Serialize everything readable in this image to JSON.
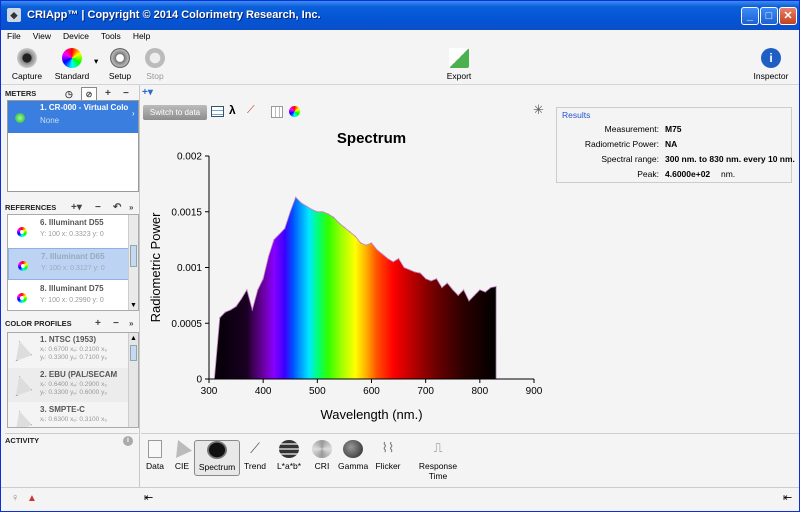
{
  "window": {
    "title": "CRIApp™ | Copyright © 2014 Colorimetry Research, Inc.",
    "app_icon": "app-icon"
  },
  "menu": [
    "File",
    "View",
    "Device",
    "Tools",
    "Help"
  ],
  "toolbar": {
    "capture": "Capture",
    "standard": "Standard",
    "setup": "Setup",
    "stop": "Stop",
    "export": "Export",
    "inspector": "Inspector"
  },
  "meters": {
    "heading": "METERS",
    "item_name": "1. CR-000 - Virtual Colo",
    "item_sub": "None"
  },
  "references": {
    "heading": "REFERENCES",
    "items": [
      {
        "name": "6. Illuminant D55",
        "sub": "Y: 100 x: 0.3323 y: 0"
      },
      {
        "name": "7. Illuminant D65",
        "sub": "Y: 100 x: 0.3127 y: 0"
      },
      {
        "name": "8. Illuminant D75",
        "sub": "Y: 100 x: 0.2990 y: 0"
      }
    ]
  },
  "profiles": {
    "heading": "COLOR PROFILES",
    "items": [
      {
        "name": "1. NTSC (1953)",
        "l1": "xᵣ: 0.6700 xₔ: 0.2100 x₉",
        "l2": "yᵣ: 0.3300 yₔ: 0.7100 y₉"
      },
      {
        "name": "2. EBU (PAL/SECAM",
        "l1": "xᵣ: 0.6400 xₔ: 0.2900 x₉",
        "l2": "yᵣ: 0.3300 yₔ: 0.6000 y₉"
      },
      {
        "name": "3. SMPTE-C",
        "l1": "xᵣ: 0.6300 xₔ: 0.3100 x₉",
        "l2": ""
      }
    ]
  },
  "activity": {
    "heading": "ACTIVITY"
  },
  "graph": {
    "switch_label": "Switch to data"
  },
  "results": {
    "legend": "Results",
    "rows": [
      {
        "k": "Measurement:",
        "v": "M75",
        "u": ""
      },
      {
        "k": "Radiometric Power:",
        "v": "NA",
        "u": ""
      },
      {
        "k": "Spectral range:",
        "v": "300 nm. to 830 nm. every 10 nm.",
        "u": ""
      },
      {
        "k": "Peak:",
        "v": "4.6000e+02",
        "u": "nm."
      }
    ]
  },
  "tabs": [
    "Data",
    "CIE",
    "Spectrum",
    "Trend",
    "L*a*b*",
    "CRI",
    "Gamma",
    "Flicker",
    "Response Time"
  ],
  "chart_data": {
    "type": "area",
    "title": "Spectrum",
    "xlabel": "Wavelength (nm.)",
    "ylabel": "Radiometric Power",
    "xlim": [
      300,
      900
    ],
    "ylim": [
      0,
      0.002
    ],
    "xticks": [
      "300",
      "400",
      "500",
      "600",
      "700",
      "800",
      "900"
    ],
    "yticks": [
      "0",
      "0.0005",
      "0.001",
      "0.0015",
      "0.002"
    ],
    "x": [
      300,
      310,
      320,
      330,
      340,
      350,
      360,
      370,
      380,
      390,
      400,
      410,
      420,
      430,
      440,
      450,
      460,
      470,
      480,
      490,
      500,
      510,
      520,
      530,
      540,
      550,
      560,
      570,
      580,
      590,
      600,
      610,
      620,
      630,
      640,
      650,
      660,
      670,
      680,
      690,
      700,
      710,
      720,
      730,
      740,
      750,
      760,
      770,
      780,
      790,
      800,
      810,
      820,
      830
    ],
    "y": [
      0,
      0,
      0.00055,
      0.0006,
      0.00062,
      0.00065,
      0.00072,
      0.0008,
      0.00062,
      0.0008,
      0.0009,
      0.0011,
      0.00125,
      0.0013,
      0.00135,
      0.0015,
      0.00163,
      0.00158,
      0.00155,
      0.00152,
      0.0015,
      0.0015,
      0.00148,
      0.00145,
      0.0014,
      0.00136,
      0.00132,
      0.00128,
      0.00122,
      0.0012,
      0.00122,
      0.00116,
      0.00112,
      0.00108,
      0.00105,
      0.00108,
      0.001,
      0.00098,
      0.00096,
      0.00095,
      0.0009,
      0.00088,
      0.0009,
      0.00082,
      0.00086,
      0.0008,
      0.00075,
      0.0008,
      0.0007,
      0.00075,
      0.0008,
      0.00078,
      0.00082,
      0.00083
    ],
    "grid": false,
    "legend": "none"
  }
}
